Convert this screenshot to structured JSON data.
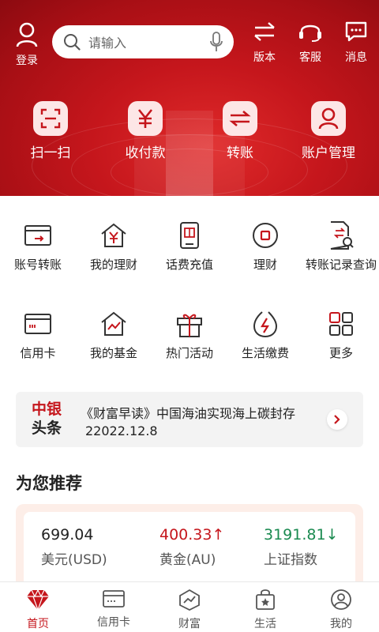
{
  "header": {
    "login_label": "登录",
    "search_placeholder": "请输入",
    "top_icons": [
      {
        "label": "版本",
        "icon": "switch-arrows-icon"
      },
      {
        "label": "客服",
        "icon": "headset-icon"
      },
      {
        "label": "消息",
        "icon": "message-icon"
      }
    ],
    "quick_actions": [
      {
        "label": "扫一扫",
        "icon": "scan-icon"
      },
      {
        "label": "收付款",
        "icon": "yuan-icon"
      },
      {
        "label": "转账",
        "icon": "transfer-icon"
      },
      {
        "label": "账户管理",
        "icon": "user-icon"
      }
    ]
  },
  "grid": [
    {
      "label": "账号转账",
      "icon": "card-transfer-icon"
    },
    {
      "label": "我的理财",
      "icon": "house-yuan-icon"
    },
    {
      "label": "话费充值",
      "icon": "phone-topup-icon"
    },
    {
      "label": "理财",
      "icon": "wealth-circle-icon"
    },
    {
      "label": "转账记录查询",
      "icon": "transfer-record-icon"
    },
    {
      "label": "信用卡",
      "icon": "credit-card-icon"
    },
    {
      "label": "我的基金",
      "icon": "house-chart-icon"
    },
    {
      "label": "热门活动",
      "icon": "gift-icon"
    },
    {
      "label": "生活缴费",
      "icon": "drop-bolt-icon"
    },
    {
      "label": "更多",
      "icon": "more-grid-icon"
    }
  ],
  "news": {
    "brand_line1": "中银",
    "brand_line2": "头条",
    "headline": "《财富早读》中国海油实现海上碳封存",
    "date": "22022.12.8"
  },
  "recommend": {
    "title": "为您推荐",
    "items": [
      {
        "value": "699.04",
        "name": "美元(USD)",
        "trend": "",
        "color": "#222222"
      },
      {
        "value": "400.33↑",
        "name": "黄金(AU)",
        "trend": "up",
        "color": "#c5161c"
      },
      {
        "value": "3191.81↓",
        "name": "上证指数",
        "trend": "down",
        "color": "#1a8a50"
      }
    ]
  },
  "tabbar": [
    {
      "label": "首页",
      "icon": "home-gem-icon",
      "active": true
    },
    {
      "label": "信用卡",
      "icon": "credit-card-tab-icon",
      "active": false
    },
    {
      "label": "财富",
      "icon": "wealth-tab-icon",
      "active": false
    },
    {
      "label": "生活",
      "icon": "shopping-bag-icon",
      "active": false
    },
    {
      "label": "我的",
      "icon": "profile-icon",
      "active": false
    }
  ],
  "colors": {
    "brand": "#c5161c",
    "up": "#c5161c",
    "down": "#1a8a50"
  }
}
